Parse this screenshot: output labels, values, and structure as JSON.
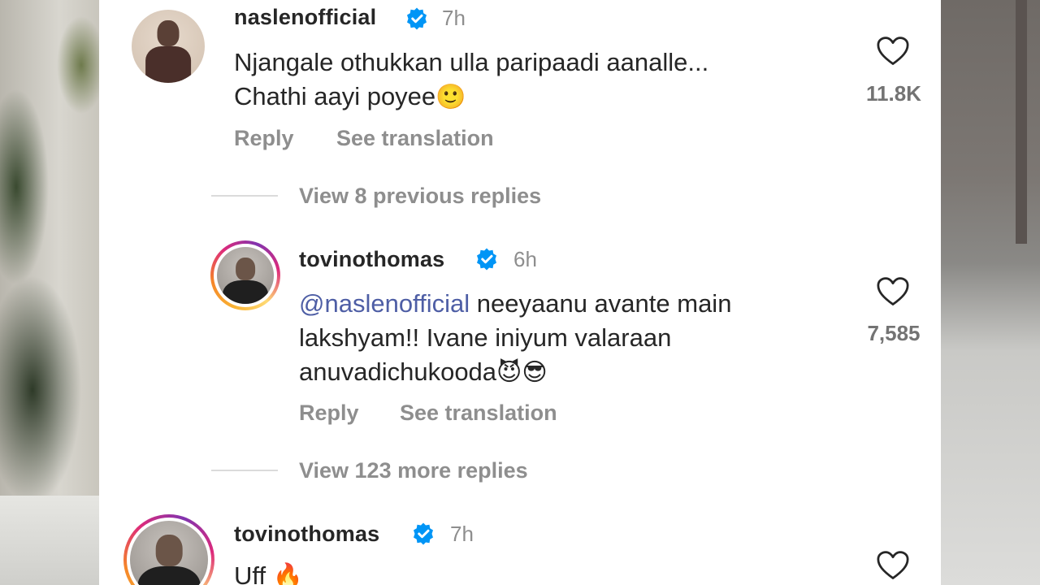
{
  "comments": [
    {
      "username": "naslenofficial",
      "time": "7h",
      "line1": "Njangale othukkan ulla paripaadi aanalle...",
      "line2": "Chathi aayi poyee",
      "emoji2": "🙂",
      "likes": "11.8K",
      "reply": "Reply",
      "translate": "See translation",
      "icons": [
        "verified-badge-icon",
        "heart-icon"
      ]
    },
    {
      "username": "tovinothomas",
      "time": "6h",
      "mention": "@naslenofficial",
      "line1_rest": " neeyaanu avante main",
      "line2": "lakshyam!! Ivane iniyum valaraan",
      "line3": "anuvadichukooda",
      "emoji3a": "😈",
      "emoji3b": "😎",
      "likes": "7,585",
      "reply": "Reply",
      "translate": "See translation",
      "icons": [
        "verified-badge-icon",
        "heart-icon"
      ]
    },
    {
      "username": "tovinothomas",
      "time": "7h",
      "line1": "Uff",
      "emoji1": "🔥",
      "icons": [
        "verified-badge-icon",
        "heart-icon"
      ]
    }
  ],
  "view_previous": "View 8 previous replies",
  "view_more": "View 123 more replies",
  "colors": {
    "text": "#262626",
    "muted": "#8e8e8e",
    "mention": "#4e5ea5",
    "verified": "#0095f6",
    "background": "#ffffff"
  }
}
